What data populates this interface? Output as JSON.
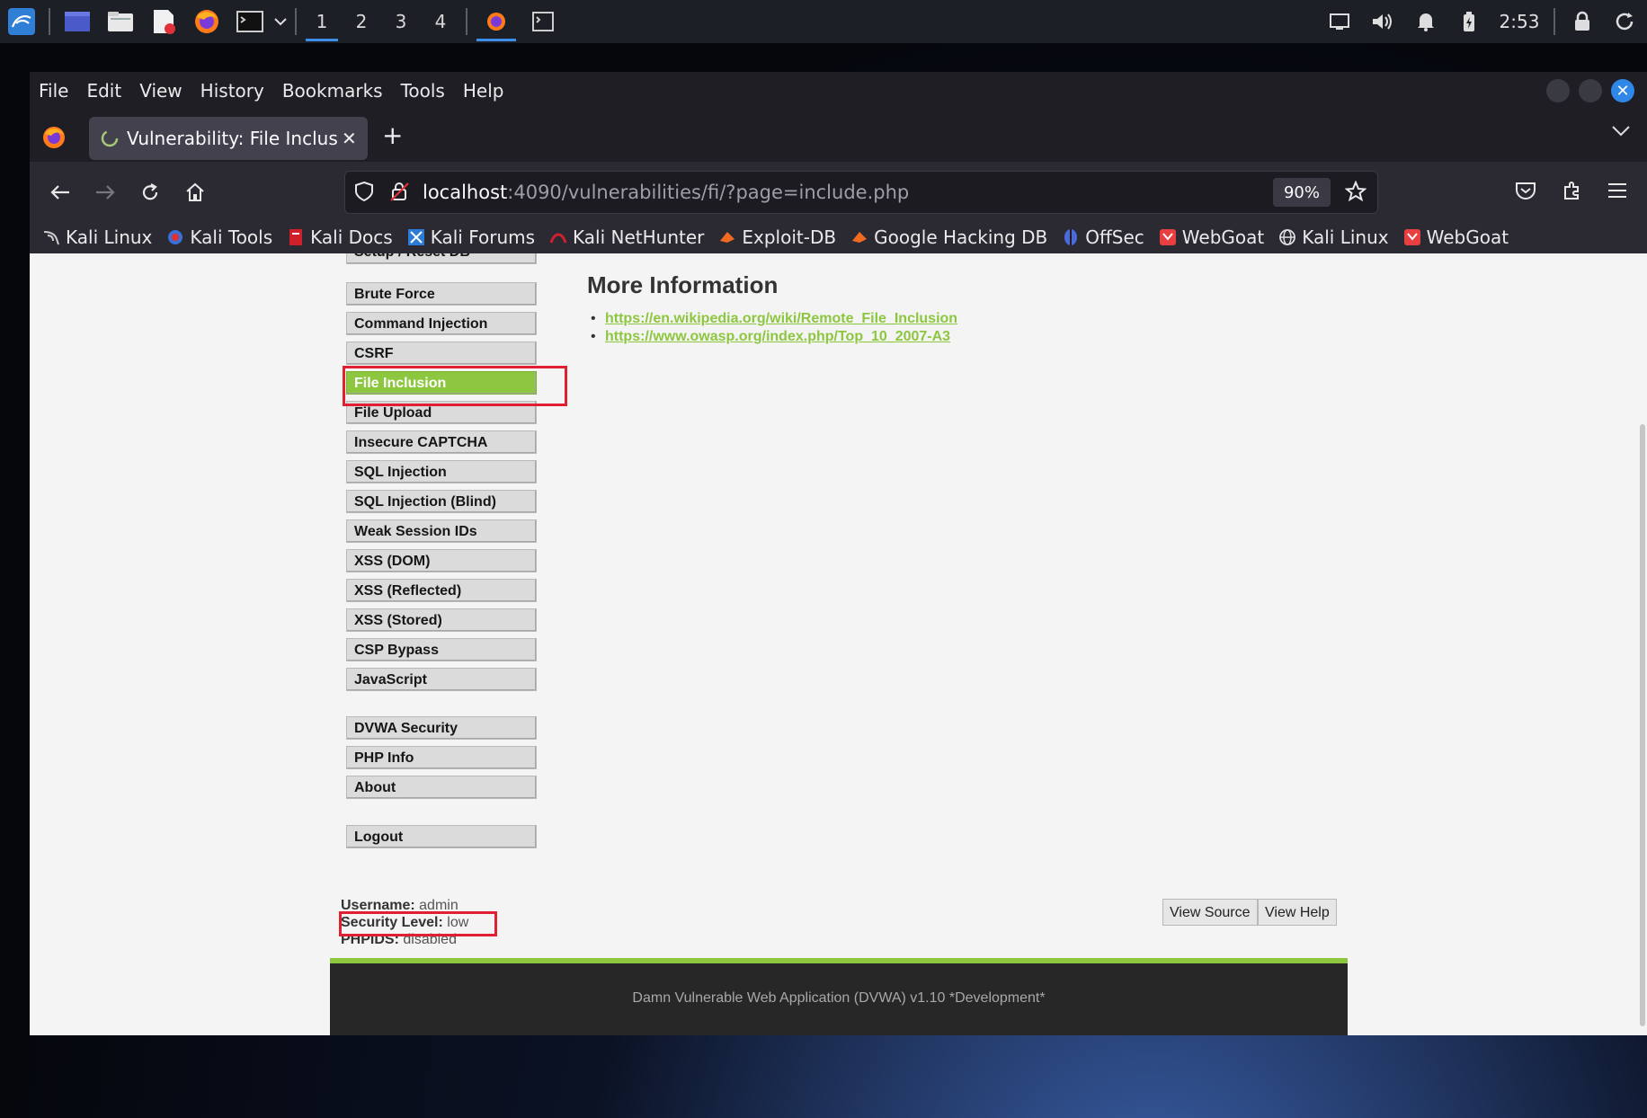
{
  "system_panel": {
    "workspaces": [
      "1",
      "2",
      "3",
      "4"
    ],
    "active_workspace": "1",
    "clock": "2:53"
  },
  "browser": {
    "menu": [
      "File",
      "Edit",
      "View",
      "History",
      "Bookmarks",
      "Tools",
      "Help"
    ],
    "tab_title": "Vulnerability: File Inclusio",
    "url_host": "localhost",
    "url_rest": ":4090/vulnerabilities/fi/?page=include.php",
    "zoom": "90%",
    "bookmarks": [
      {
        "label": "Kali Linux",
        "icon": "kali-dragon-icon"
      },
      {
        "label": "Kali Tools",
        "icon": "kali-tools-icon"
      },
      {
        "label": "Kali Docs",
        "icon": "kali-docs-icon"
      },
      {
        "label": "Kali Forums",
        "icon": "kali-forums-icon"
      },
      {
        "label": "Kali NetHunter",
        "icon": "nethunter-icon"
      },
      {
        "label": "Exploit-DB",
        "icon": "exploit-db-icon"
      },
      {
        "label": "Google Hacking DB",
        "icon": "ghdb-icon"
      },
      {
        "label": "OffSec",
        "icon": "offsec-icon"
      },
      {
        "label": "WebGoat",
        "icon": "webgoat-icon"
      },
      {
        "label": "Kali Linux",
        "icon": "globe-icon"
      },
      {
        "label": "WebGoat",
        "icon": "webgoat-icon"
      }
    ]
  },
  "dvwa": {
    "partial_top_item": "Setup / Reset DB",
    "menu_groups": [
      [
        "Brute Force",
        "Command Injection",
        "CSRF",
        "File Inclusion",
        "File Upload",
        "Insecure CAPTCHA",
        "SQL Injection",
        "SQL Injection (Blind)",
        "Weak Session IDs",
        "XSS (DOM)",
        "XSS (Reflected)",
        "XSS (Stored)",
        "CSP Bypass",
        "JavaScript"
      ],
      [
        "DVWA Security",
        "PHP Info",
        "About"
      ],
      [
        "Logout"
      ]
    ],
    "selected_item": "File Inclusion",
    "more_info_title": "More Information",
    "links": [
      "https://en.wikipedia.org/wiki/Remote_File_Inclusion",
      "https://www.owasp.org/index.php/Top_10_2007-A3"
    ],
    "user": {
      "username_label": "Username:",
      "username": "admin",
      "security_label": "Security Level:",
      "security": "low",
      "phpids_label": "PHPIDS:",
      "phpids": "disabled"
    },
    "view_source": "View Source",
    "view_help": "View Help",
    "footer": "Damn Vulnerable Web Application (DVWA) v1.10 *Development*"
  },
  "colors": {
    "accent_green": "#8dc63f",
    "highlight_red": "#e02030",
    "panel_bg": "#1c1f26",
    "active_indicator": "#3d8ee8"
  }
}
